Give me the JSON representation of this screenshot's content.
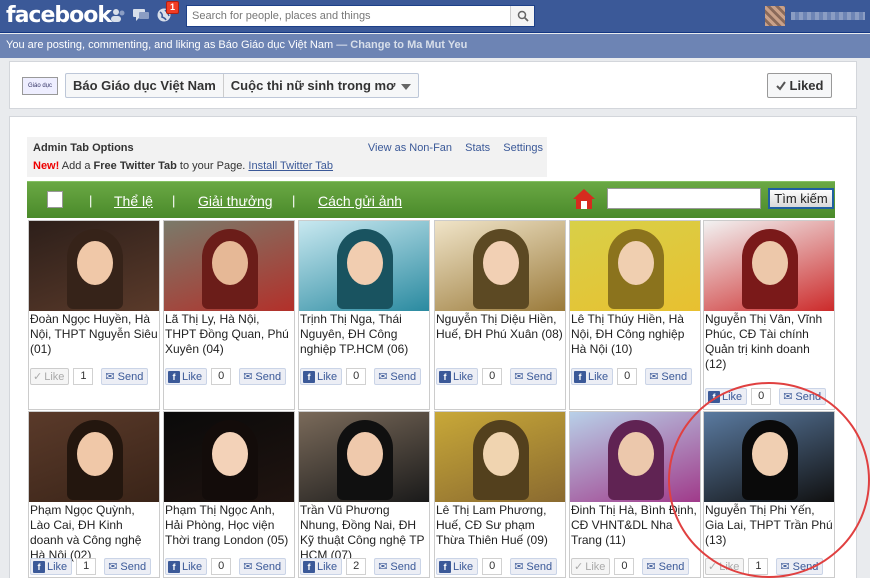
{
  "topbar": {
    "logo": "facebook",
    "notification_count": "1",
    "search_placeholder": "Search for people, places and things"
  },
  "postbar": {
    "text": "You are posting, commenting, and liking as Báo Giáo dục Việt Nam — ",
    "change_link": "Change to Ma Mut Yeu"
  },
  "pagehead": {
    "logo_text": "Giáo dục",
    "page_name": "Báo Giáo dục Việt Nam",
    "tab_name": "Cuộc thi nữ sinh trong mơ",
    "liked_label": "Liked"
  },
  "admin": {
    "title": "Admin Tab Options",
    "links": [
      "View as Non-Fan",
      "Stats",
      "Settings"
    ],
    "new_label": "New!",
    "line_text_a": "Add a ",
    "line_bold": "Free Twitter Tab",
    "line_text_b": " to your Page. ",
    "install_link": "Install Twitter Tab"
  },
  "nav": {
    "links": [
      "Thể lệ",
      "Giải thưởng",
      "Cách gửi ảnh"
    ],
    "search_button": "Tìm kiếm"
  },
  "like_label": "Like",
  "send_label": "Send",
  "cards_row1": [
    {
      "caption": "Đoàn Ngọc Huyền, Hà Nội, THPT Nguyễn Siêu (01)",
      "count": "1",
      "like_disabled": true
    },
    {
      "caption": "Lã Thị Ly, Hà Nội, THPT Đồng Quan, Phú Xuyên (04)",
      "count": "0",
      "like_disabled": false
    },
    {
      "caption": "Trịnh Thị Nga, Thái Nguyên, ĐH Công nghiệp TP.HCM (06)",
      "count": "0",
      "like_disabled": false
    },
    {
      "caption": "Nguyễn Thị Diệu Hiền, Huế, ĐH Phú Xuân (08)",
      "count": "0",
      "like_disabled": false
    },
    {
      "caption": "Lê Thị Thúy Hiền, Hà Nội, ĐH Công nghiệp Hà Nội (10)",
      "count": "0",
      "like_disabled": false
    },
    {
      "caption": "Nguyễn Thị Vân, Vĩnh Phúc, CĐ Tài chính Quản trị kinh doanh (12)",
      "count": "0",
      "like_disabled": false
    }
  ],
  "cards_row2": [
    {
      "caption": "Phạm Ngọc Quỳnh, Lào Cai, ĐH Kinh doanh và Công nghệ Hà Nội (02)",
      "count": "1",
      "like_disabled": false
    },
    {
      "caption": "Phạm Thị Ngọc Anh, Hải Phòng, Học viện Thời trang London (05)",
      "count": "0",
      "like_disabled": false
    },
    {
      "caption": "Trần Vũ Phương Nhung, Đồng Nai, ĐH Kỹ thuật Công nghệ TP HCM (07)",
      "count": "2",
      "like_disabled": false
    },
    {
      "caption": "Lê Thị Lam Phương, Huế, CĐ Sư phạm Thừa Thiên Huế (09)",
      "count": "0",
      "like_disabled": false
    },
    {
      "caption": "Đinh Thị Hà, Bình Định, CĐ VHNT&DL Nha Trang (11)",
      "count": "0",
      "like_disabled": true
    },
    {
      "caption": "Nguyễn Thị Phi Yến, Gia Lai, THPT Trần Phú (13)",
      "count": "1",
      "like_disabled": true
    }
  ]
}
